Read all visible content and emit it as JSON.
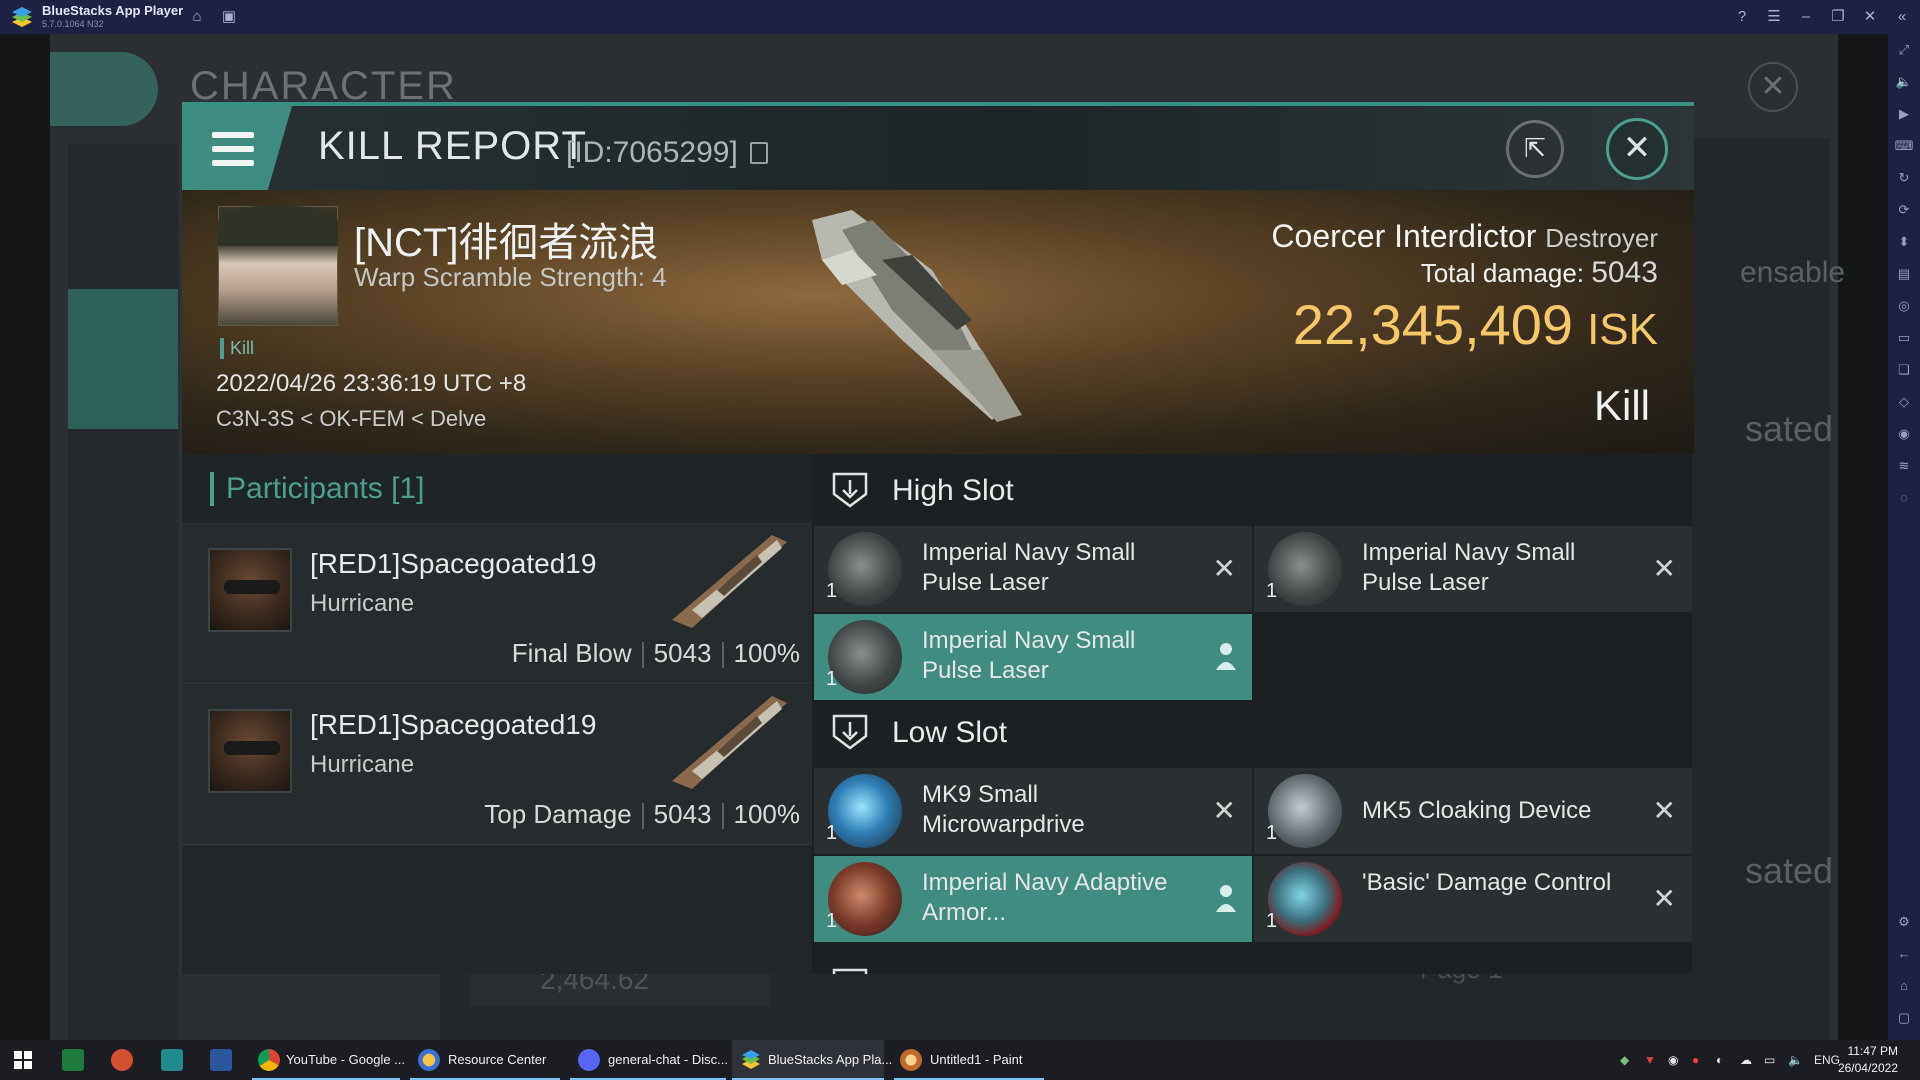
{
  "window": {
    "title": "BlueStacks App Player",
    "version": "5.7.0.1064 N32"
  },
  "background": {
    "title": "CHARACTER",
    "right_texts": [
      "ensable",
      "sated",
      "sated"
    ],
    "bottom_value": "2,464.62",
    "page_label": "Page 1"
  },
  "modal": {
    "title": "KILL REPORT",
    "report_id": "[ID:7065299]",
    "victim": {
      "name": "[NCT]徘徊者流浪",
      "subtitle": "Warp Scramble Strength: 4",
      "tag": "Kill",
      "datetime": "2022/04/26 23:36:19 UTC +8",
      "location": "C3N-3S < OK-FEM < Delve"
    },
    "ship": {
      "name": "Coercer Interdictor",
      "class": "Destroyer",
      "total_damage_label": "Total damage:",
      "total_damage": "5043",
      "isk_value": "22,345,409",
      "isk_unit": "ISK",
      "result": "Kill"
    },
    "participants": {
      "title": "Participants",
      "count": "[1]",
      "rows": [
        {
          "name": "[RED1]Spacegoated19",
          "ship": "Hurricane",
          "role": "Final Blow",
          "damage": "5043",
          "percent": "100%"
        },
        {
          "name": "[RED1]Spacegoated19",
          "ship": "Hurricane",
          "role": "Top Damage",
          "damage": "5043",
          "percent": "100%"
        }
      ]
    },
    "fittings": {
      "high_slot_label": "High Slot",
      "low_slot_label": "Low Slot",
      "high": [
        {
          "name": "Imperial Navy Small Pulse Laser",
          "qty": "1",
          "status": "destroyed"
        },
        {
          "name": "Imperial Navy Small Pulse Laser",
          "qty": "1",
          "status": "destroyed"
        },
        {
          "name": "Imperial Navy Small Pulse Laser",
          "qty": "1",
          "status": "dropped"
        }
      ],
      "low": [
        {
          "name": "MK9 Small Microwarpdrive",
          "qty": "1",
          "status": "destroyed"
        },
        {
          "name": "MK5 Cloaking Device",
          "qty": "1",
          "status": "destroyed"
        },
        {
          "name": "Imperial Navy Adaptive Armor...",
          "qty": "1",
          "status": "dropped"
        },
        {
          "name": "'Basic' Damage Control",
          "qty": "1",
          "status": "destroyed"
        }
      ]
    }
  },
  "taskbar": {
    "items": [
      {
        "label": "YouTube - Google ..."
      },
      {
        "label": "Resource Center"
      },
      {
        "label": "general-chat - Disc..."
      },
      {
        "label": "BlueStacks App Pla..."
      },
      {
        "label": "Untitled1 - Paint"
      }
    ],
    "language": "ENG",
    "time": "11:47 PM",
    "date": "26/04/2022"
  },
  "colors": {
    "accent": "#3f8c80",
    "isk": "#f5c96a",
    "titlebar": "#1d2142"
  }
}
